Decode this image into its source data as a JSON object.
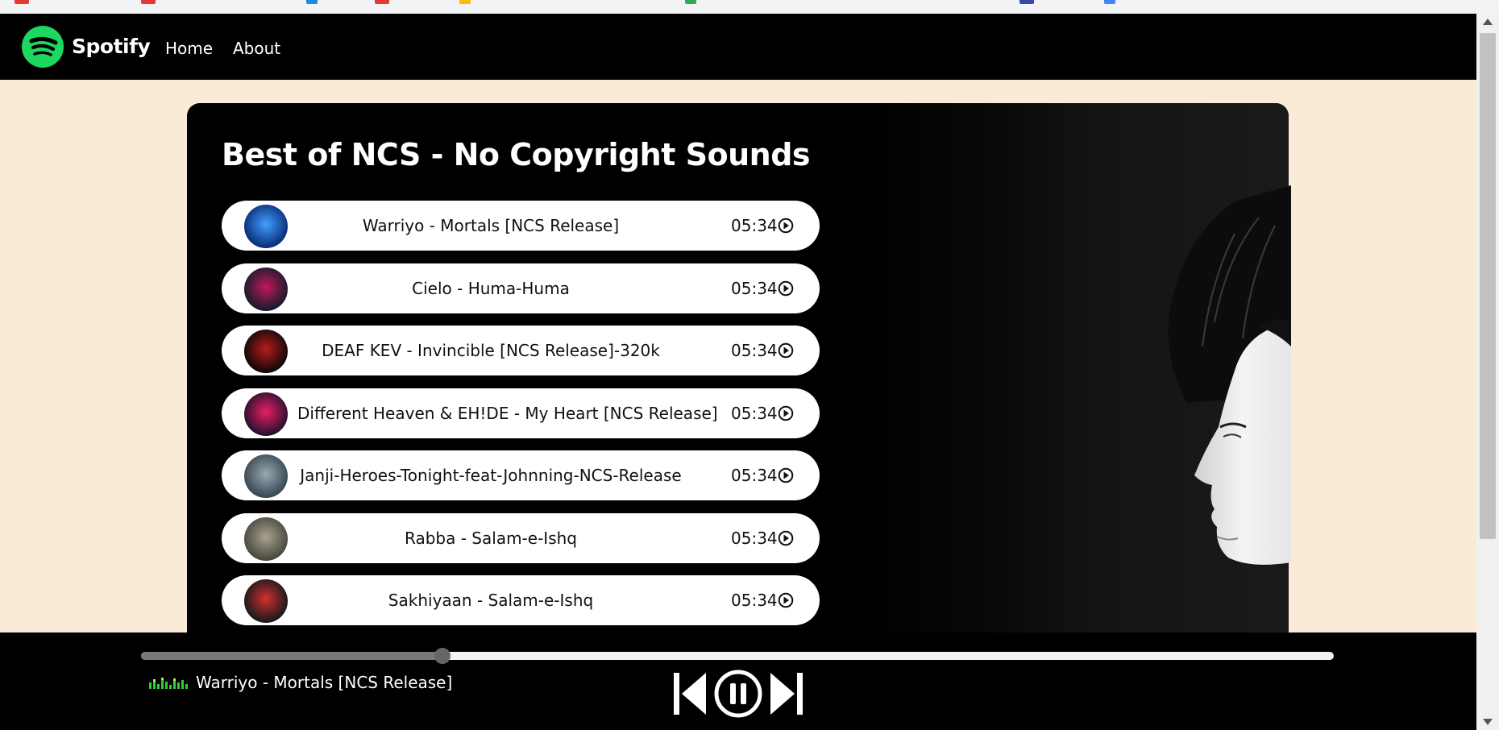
{
  "app": {
    "brand": "Spotify"
  },
  "nav": {
    "links": [
      "Home",
      "About"
    ]
  },
  "playlist": {
    "title": "Best of NCS - No Copyright Sounds",
    "songs": [
      {
        "name": "Warriyo - Mortals [NCS Release]",
        "duration": "05:34",
        "cover_colors": [
          "#0b2f7a",
          "#3fa0ff"
        ]
      },
      {
        "name": "Cielo - Huma-Huma",
        "duration": "05:34",
        "cover_colors": [
          "#1a1a2e",
          "#c2185b"
        ]
      },
      {
        "name": "DEAF KEV - Invincible [NCS Release]-320k",
        "duration": "05:34",
        "cover_colors": [
          "#120808",
          "#b71c1c"
        ]
      },
      {
        "name": "Different Heaven & EH!DE - My Heart [NCS Release]",
        "duration": "05:34",
        "cover_colors": [
          "#2b1030",
          "#e91e63"
        ]
      },
      {
        "name": "Janji-Heroes-Tonight-feat-Johnning-NCS-Release",
        "duration": "05:34",
        "cover_colors": [
          "#3a4a55",
          "#9aa8b2"
        ]
      },
      {
        "name": "Rabba - Salam-e-Ishq",
        "duration": "05:34",
        "cover_colors": [
          "#4a4a40",
          "#a8a290"
        ]
      },
      {
        "name": "Sakhiyaan - Salam-e-Ishq",
        "duration": "05:34",
        "cover_colors": [
          "#1a1a1a",
          "#d32f2f"
        ]
      }
    ]
  },
  "player": {
    "now_playing": "Warriyo - Mortals [NCS Release]",
    "progress_fraction": 0.253,
    "icons": [
      "previous-icon",
      "pause-icon",
      "next-icon"
    ]
  },
  "colors": {
    "background": "#faebd7",
    "spotify_green": "#1ed760",
    "panel": "#000000"
  }
}
